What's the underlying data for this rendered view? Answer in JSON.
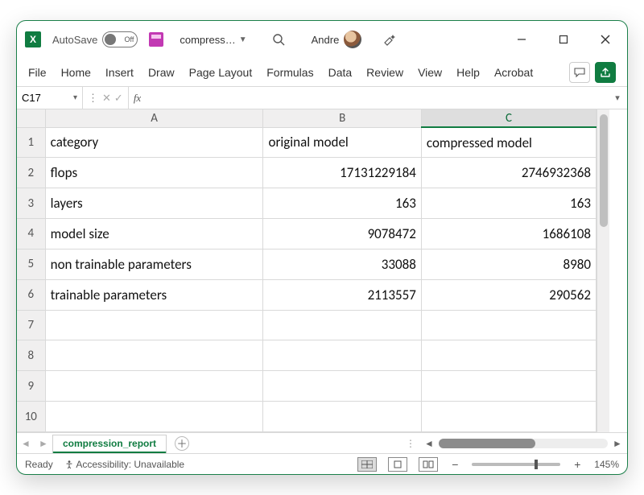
{
  "titlebar": {
    "autosave_label": "AutoSave",
    "autosave_state": "Off",
    "filename": "compress…",
    "user_name": "Andre"
  },
  "ribbon": {
    "tabs": [
      "File",
      "Home",
      "Insert",
      "Draw",
      "Page Layout",
      "Formulas",
      "Data",
      "Review",
      "View",
      "Help",
      "Acrobat"
    ]
  },
  "formula_bar": {
    "namebox": "C17",
    "fx_label": "fx",
    "formula": ""
  },
  "grid": {
    "column_headers": [
      "A",
      "B",
      "C"
    ],
    "selected_column": "C",
    "row_count": 10,
    "rows": [
      {
        "A": "category",
        "B": "original model",
        "C": "compressed model"
      },
      {
        "A": "flops",
        "B": "17131229184",
        "C": "2746932368"
      },
      {
        "A": "layers",
        "B": "163",
        "C": "163"
      },
      {
        "A": "model size",
        "B": "9078472",
        "C": "1686108"
      },
      {
        "A": "non trainable parameters",
        "B": "33088",
        "C": "8980"
      },
      {
        "A": "trainable parameters",
        "B": "2113557",
        "C": "290562"
      }
    ]
  },
  "sheet_tabs": {
    "active": "compression_report"
  },
  "status": {
    "state": "Ready",
    "accessibility": "Accessibility: Unavailable",
    "zoom": "145%"
  }
}
